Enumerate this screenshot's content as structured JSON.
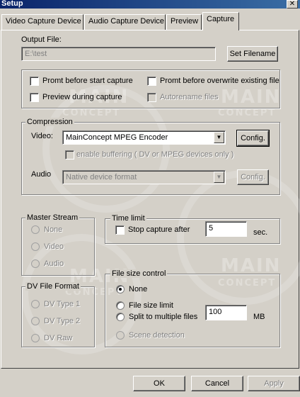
{
  "window": {
    "title": "Setup"
  },
  "tabs": [
    {
      "label": "Video Capture Device"
    },
    {
      "label": "Audio Capture Device"
    },
    {
      "label": "Preview"
    },
    {
      "label": "Capture"
    }
  ],
  "watermark": {
    "text_main": "MAIN",
    "text_concept": "CONCEPT"
  },
  "output": {
    "label": "Output File:",
    "value": "E:\\test",
    "set_filename_label": "Set Filename"
  },
  "options": {
    "prompt_before_start": "Promt before start capture",
    "prompt_before_overwrite": "Promt before overwrite existing file",
    "preview_during_capture": "Preview during capture",
    "autorename_files": "Autorename files"
  },
  "compression": {
    "title": "Compression",
    "video_label": "Video:",
    "video_value": "MainConcept MPEG Encoder",
    "video_config_label": "Config.",
    "enable_buffering": "enable buffering ( DV or MPEG devices only )",
    "audio_label": "Audio",
    "audio_value": "Native device format",
    "audio_config_label": "Config."
  },
  "master_stream": {
    "title": "Master Stream",
    "options": [
      "None",
      "Video",
      "Audio"
    ]
  },
  "time_limit": {
    "title": "Time limit",
    "stop_capture_after": "Stop capture after",
    "value": "5",
    "unit": "sec."
  },
  "dv_file_format": {
    "title": "DV File  Format",
    "options": [
      "DV Type 1",
      "DV Type 2",
      "DV Raw"
    ]
  },
  "file_size_control": {
    "title": "File size control",
    "none": "None",
    "file_size_limit": "File size limit",
    "split_to_multiple": "Split to multiple files",
    "value": "100",
    "unit": "MB",
    "scene_detection": "Scene detection"
  },
  "buttons": {
    "ok": "OK",
    "cancel": "Cancel",
    "apply": "Apply"
  }
}
